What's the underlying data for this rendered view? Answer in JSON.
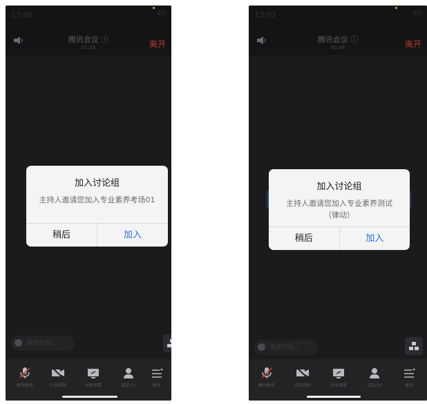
{
  "phones": [
    {
      "status_time": "13:06",
      "status_right": "4G",
      "meeting_title": "腾讯会议 ⓘ",
      "timer": "01:25",
      "leave_label": "离开",
      "dialog": {
        "title": "加入讨论组",
        "message": "主持人邀请您加入专业素养考场01",
        "later_label": "稍后",
        "join_label": "加入"
      },
      "comment_placeholder": "说点什么...",
      "toolbar": [
        "解除静音",
        "开启视频",
        "共享屏幕",
        "成员(3)",
        "更多"
      ]
    },
    {
      "status_time": "13:03",
      "status_right": "4G",
      "meeting_title": "腾讯会议 ⓘ",
      "timer": "00:08",
      "leave_label": "离开",
      "dialog": {
        "title": "加入讨论组",
        "message": "主持人邀请您加入专业素养测试（律动）",
        "later_label": "稍后",
        "join_label": "加入"
      },
      "comment_placeholder": "说点什么...",
      "toolbar": [
        "解除静音",
        "开启视频",
        "共享屏幕",
        "成员(3)",
        "更多"
      ]
    }
  ],
  "colors": {
    "leave": "#b23a2e",
    "join": "#2a6fd9",
    "dialog_bg": "#f4f4f5",
    "stage_bg": "#1b1b1d"
  }
}
